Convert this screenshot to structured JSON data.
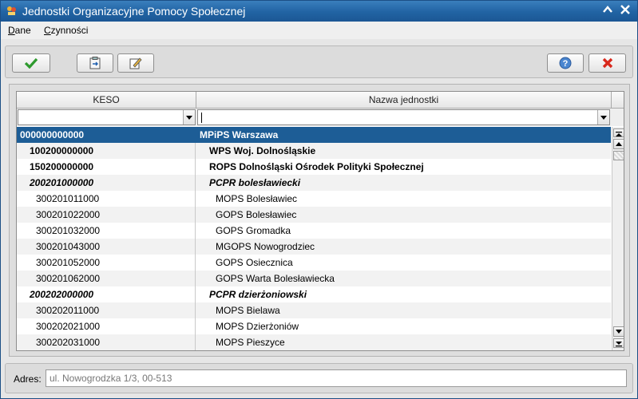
{
  "window": {
    "title": "Jednostki Organizacyjne Pomocy Społecznej"
  },
  "menu": [
    {
      "label": "Dane"
    },
    {
      "label": "Czynności"
    }
  ],
  "toolbar": {
    "accept_icon": "checkmark-icon",
    "import_icon": "clipboard-arrow-icon",
    "edit_icon": "edit-icon",
    "help_icon": "help-icon",
    "cancel_icon": "red-x-icon"
  },
  "grid": {
    "columns": [
      "KESO",
      "Nazwa jednostki"
    ],
    "filter_keso": "",
    "filter_name": "",
    "rows": [
      {
        "keso": "000000000000",
        "name": "MPiPS Warszawa",
        "level": 0,
        "selected": true
      },
      {
        "keso": "100200000000",
        "name": "WPS Woj. Dolnośląskie",
        "level": 1
      },
      {
        "keso": "150200000000",
        "name": "ROPS Dolnośląski Ośrodek Polityki Społecznej",
        "level": 1
      },
      {
        "keso": "200201000000",
        "name": "PCPR bolesławiecki",
        "level": 2
      },
      {
        "keso": "300201011000",
        "name": "MOPS Bolesławiec",
        "level": 3
      },
      {
        "keso": "300201022000",
        "name": "GOPS Bolesławiec",
        "level": 3
      },
      {
        "keso": "300201032000",
        "name": "GOPS Gromadka",
        "level": 3
      },
      {
        "keso": "300201043000",
        "name": "MGOPS Nowogrodziec",
        "level": 3
      },
      {
        "keso": "300201052000",
        "name": "GOPS Osiecznica",
        "level": 3
      },
      {
        "keso": "300201062000",
        "name": "GOPS Warta Bolesławiecka",
        "level": 3
      },
      {
        "keso": "200202000000",
        "name": "PCPR dzierżoniowski",
        "level": 2
      },
      {
        "keso": "300202011000",
        "name": "MOPS Bielawa",
        "level": 3
      },
      {
        "keso": "300202021000",
        "name": "MOPS Dzierżoniów",
        "level": 3
      },
      {
        "keso": "300202031000",
        "name": "MOPS Pieszyce",
        "level": 3
      }
    ]
  },
  "address": {
    "label": "Adres:",
    "value": "ul. Nowogrodzka 1/3, 00-513"
  },
  "colors": {
    "titlebar": "#2163a3",
    "selection": "#1d5d96"
  }
}
